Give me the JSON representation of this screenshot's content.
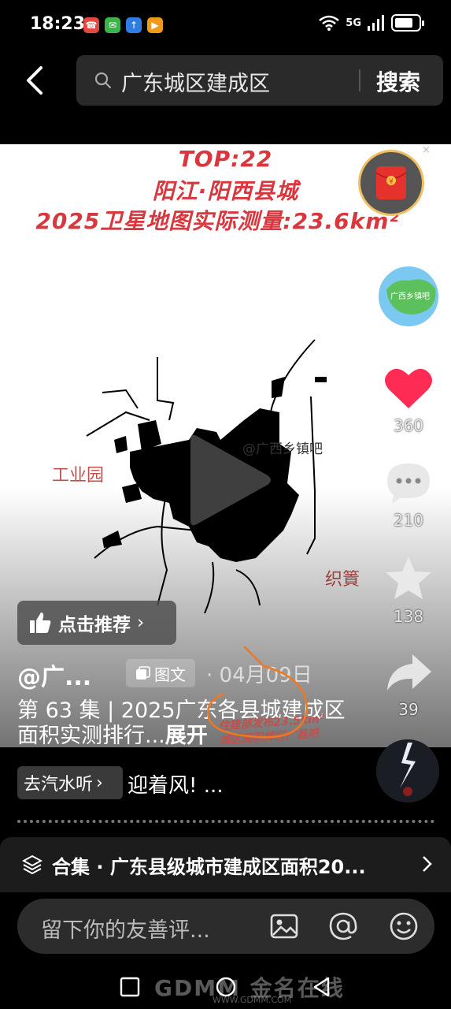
{
  "status_bar": {
    "time": "18:23",
    "network": "5G",
    "icons": [
      "missed-call-icon",
      "wechat-icon",
      "upload-icon",
      "app-icon",
      "wifi-icon",
      "signal-icon",
      "battery-icon"
    ]
  },
  "header": {
    "search_query": "广东城区建成区",
    "search_button": "搜索"
  },
  "post_image": {
    "title_line1": "TOP:22",
    "title_line2": "阳江·阳西县城",
    "title_line3": "2025卫星地图实际测量:23.6km²",
    "label_left": "工业园",
    "label_right": "织篢",
    "watermark": "@广西乡镇吧",
    "stamp_line1": "住建部发布23.5km²",
    "stamp_line2": "城区面积排行广县吧"
  },
  "rail": {
    "likes": "360",
    "comments": "210",
    "favorites": "138",
    "shares": "39",
    "avatar_label": "广西乡镇吧"
  },
  "post": {
    "recommend_label": "点击推荐",
    "author": "@广...",
    "type_badge": "图文",
    "separator": "·",
    "date": "04月09日",
    "description": "第 63 集 | 2025广东各县城建成区面积实测排行",
    "expand": "展开"
  },
  "music": {
    "chip_label": "去汽水听",
    "title": "迎着风! ..."
  },
  "collection": {
    "label": "合集 · 广东县级城市建成区面积20..."
  },
  "comment": {
    "placeholder": "留下你的友善评..."
  },
  "watermark_site": {
    "name": "GDMM 金名在线",
    "url": "WWW.GDMM.COM"
  },
  "colors": {
    "accent_red": "#d9363e",
    "like_red": "#fe2c55",
    "background": "#000000"
  }
}
